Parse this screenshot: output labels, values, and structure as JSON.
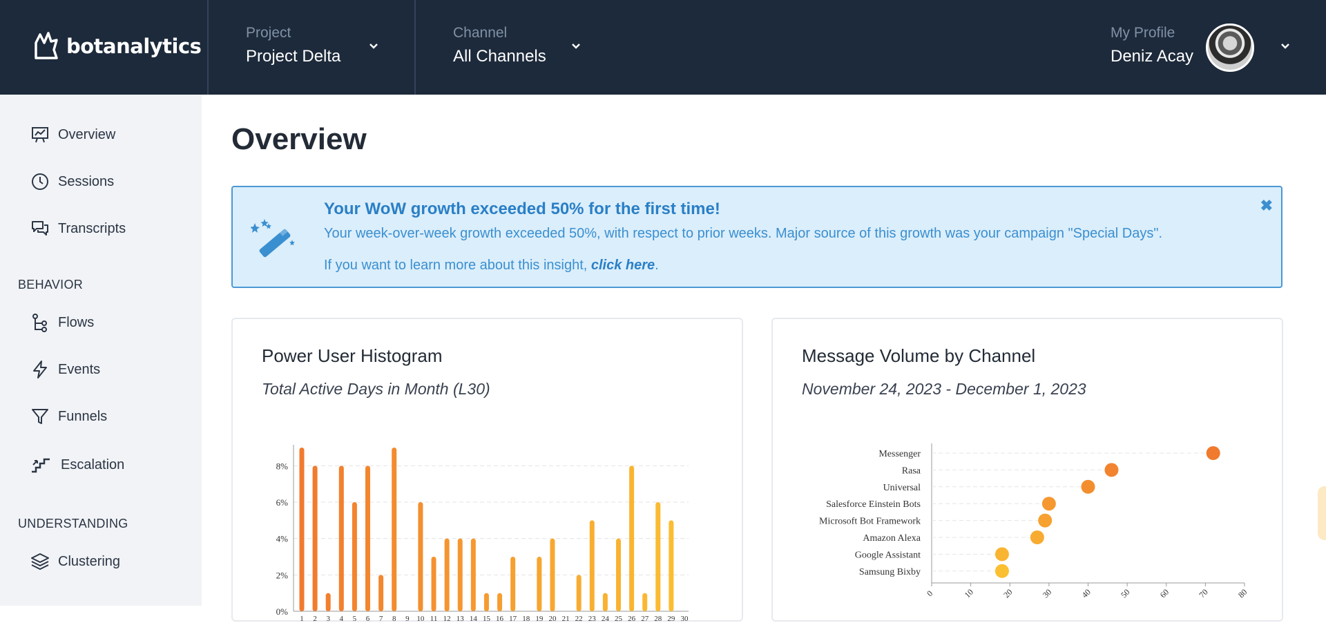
{
  "brand": {
    "name": "botanalytics"
  },
  "header": {
    "project": {
      "label": "Project",
      "value": "Project Delta"
    },
    "channel": {
      "label": "Channel",
      "value": "All Channels"
    },
    "profile": {
      "label": "My Profile",
      "value": "Deniz Acay"
    }
  },
  "sidebar": {
    "items": [
      {
        "label": "Overview",
        "icon": "presentation-chart-icon"
      },
      {
        "label": "Sessions",
        "icon": "clock-icon"
      },
      {
        "label": "Transcripts",
        "icon": "chat-bubbles-icon"
      }
    ],
    "sections": [
      {
        "title": "BEHAVIOR",
        "items": [
          {
            "label": "Flows",
            "icon": "flow-icon"
          },
          {
            "label": "Events",
            "icon": "bolt-icon"
          },
          {
            "label": "Funnels",
            "icon": "funnel-icon"
          },
          {
            "label": "Escalation",
            "icon": "stairs-icon"
          }
        ]
      },
      {
        "title": "UNDERSTANDING",
        "items": [
          {
            "label": "Clustering",
            "icon": "layers-icon"
          }
        ]
      }
    ]
  },
  "main": {
    "title": "Overview",
    "insight": {
      "title": "Your WoW growth exceeded 50% for the first time!",
      "body": "Your week-over-week growth exceeded 50%, with respect to prior weeks. Major source of this growth was your campaign \"Special Days\".",
      "more_prefix": "If you want to learn more about this insight, ",
      "more_link": "click here",
      "more_suffix": ".",
      "icon": "magic-wand-icon",
      "close_icon": "close-icon"
    },
    "cards": [
      {
        "title": "Power User Histogram",
        "subtitle": "Total Active Days in Month (L30)"
      },
      {
        "title": "Message Volume by Channel",
        "subtitle": "November 24, 2023 - December 1, 2023"
      }
    ]
  },
  "chart_data": [
    {
      "type": "bar",
      "title": "Power User Histogram",
      "subtitle": "Total Active Days in Month (L30)",
      "categories": [
        "1",
        "2",
        "3",
        "4",
        "5",
        "6",
        "7",
        "8",
        "9",
        "10",
        "11",
        "12",
        "13",
        "14",
        "15",
        "16",
        "17",
        "18",
        "19",
        "20",
        "21",
        "22",
        "23",
        "24",
        "25",
        "26",
        "27",
        "28",
        "29",
        "30"
      ],
      "values": [
        9,
        8,
        1,
        8,
        6,
        8,
        2,
        9,
        0,
        6,
        3,
        4,
        4,
        4,
        1,
        1,
        3,
        0,
        3,
        4,
        0,
        2,
        5,
        1,
        4,
        8,
        1,
        6,
        5,
        0
      ],
      "ylim": [
        0,
        9
      ],
      "yticks": [
        "0%",
        "2%",
        "4%",
        "6%",
        "8%"
      ],
      "grid": true,
      "colors": [
        "#f07a2e",
        "#fbbf32"
      ]
    },
    {
      "type": "scatter",
      "title": "Message Volume by Channel",
      "subtitle": "November 24, 2023 - December 1, 2023",
      "categories": [
        "Messenger",
        "Rasa",
        "Universal",
        "Salesforce Einstein Bots",
        "Microsoft Bot Framework",
        "Amazon Alexa",
        "Google Assistant",
        "Samsung Bixby"
      ],
      "values": [
        72,
        46,
        40,
        30,
        29,
        27,
        18,
        18
      ],
      "xlim": [
        0,
        80
      ],
      "xticks": [
        "0",
        "10",
        "20",
        "30",
        "40",
        "50",
        "60",
        "70",
        "80"
      ],
      "grid": true,
      "colors": [
        "#f07a2e",
        "#fbbf32"
      ]
    }
  ]
}
